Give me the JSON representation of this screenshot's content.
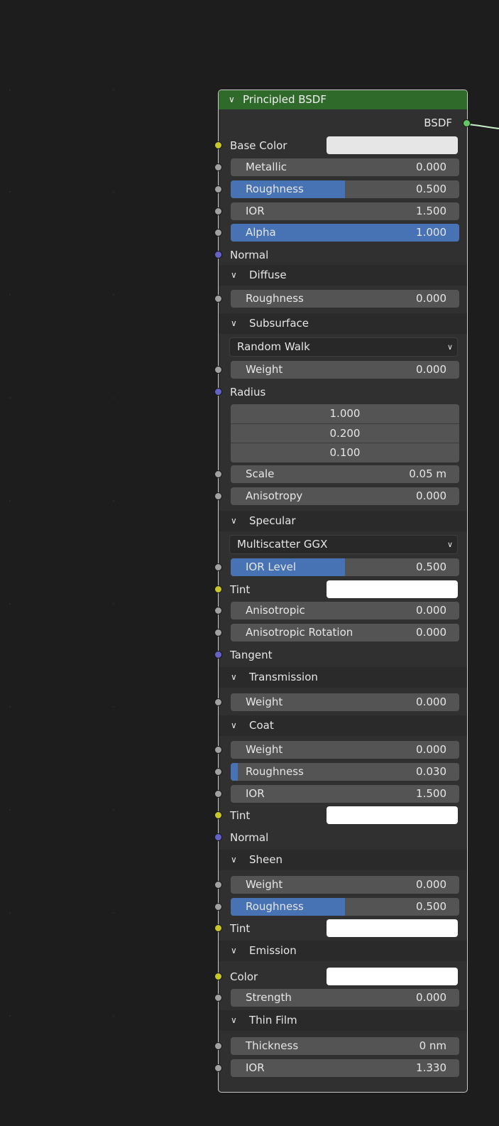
{
  "node": {
    "title": "Principled BSDF",
    "output": {
      "label": "BSDF"
    },
    "base_color": {
      "label": "Base Color",
      "color": "#e6e6e6"
    },
    "metallic": {
      "label": "Metallic",
      "value": "0.000",
      "fraction": 0
    },
    "roughness": {
      "label": "Roughness",
      "value": "0.500",
      "fraction": 0.5
    },
    "ior": {
      "label": "IOR",
      "value": "1.500",
      "fraction": 0
    },
    "alpha": {
      "label": "Alpha",
      "value": "1.000",
      "fraction": 1
    },
    "normal": {
      "label": "Normal"
    },
    "diffuse": {
      "title": "Diffuse",
      "roughness": {
        "label": "Roughness",
        "value": "0.000",
        "fraction": 0
      }
    },
    "subsurface": {
      "title": "Subsurface",
      "method": "Random Walk",
      "weight": {
        "label": "Weight",
        "value": "0.000",
        "fraction": 0
      },
      "radius": {
        "label": "Radius",
        "values": [
          "1.000",
          "0.200",
          "0.100"
        ]
      },
      "scale": {
        "label": "Scale",
        "value": "0.05 m",
        "fraction": 0
      },
      "anisotropy": {
        "label": "Anisotropy",
        "value": "0.000",
        "fraction": 0
      }
    },
    "specular": {
      "title": "Specular",
      "distribution": "Multiscatter GGX",
      "ior_level": {
        "label": "IOR Level",
        "value": "0.500",
        "fraction": 0.5
      },
      "tint": {
        "label": "Tint",
        "color": "#ffffff"
      },
      "anisotropic": {
        "label": "Anisotropic",
        "value": "0.000",
        "fraction": 0
      },
      "anisotropic_rotation": {
        "label": "Anisotropic Rotation",
        "value": "0.000",
        "fraction": 0
      },
      "tangent": {
        "label": "Tangent"
      }
    },
    "transmission": {
      "title": "Transmission",
      "weight": {
        "label": "Weight",
        "value": "0.000",
        "fraction": 0
      }
    },
    "coat": {
      "title": "Coat",
      "weight": {
        "label": "Weight",
        "value": "0.000",
        "fraction": 0
      },
      "roughness": {
        "label": "Roughness",
        "value": "0.030",
        "fraction": 0.03
      },
      "ior": {
        "label": "IOR",
        "value": "1.500",
        "fraction": 0
      },
      "tint": {
        "label": "Tint",
        "color": "#ffffff"
      },
      "normal": {
        "label": "Normal"
      }
    },
    "sheen": {
      "title": "Sheen",
      "weight": {
        "label": "Weight",
        "value": "0.000",
        "fraction": 0
      },
      "roughness": {
        "label": "Roughness",
        "value": "0.500",
        "fraction": 0.5
      },
      "tint": {
        "label": "Tint",
        "color": "#ffffff"
      }
    },
    "emission": {
      "title": "Emission",
      "color": {
        "label": "Color",
        "color": "#ffffff"
      },
      "strength": {
        "label": "Strength",
        "value": "0.000",
        "fraction": 0
      }
    },
    "thin_film": {
      "title": "Thin Film",
      "thickness": {
        "label": "Thickness",
        "value": "0 nm",
        "fraction": 0
      },
      "ior": {
        "label": "IOR",
        "value": "1.330",
        "fraction": 0
      }
    }
  },
  "colors": {
    "header": "#2f6a2a",
    "slider_fill": "#4772b3",
    "socket_float": "#a1a1a1",
    "socket_color": "#c7c729",
    "socket_vector": "#6363c7",
    "socket_shader": "#63c763"
  }
}
